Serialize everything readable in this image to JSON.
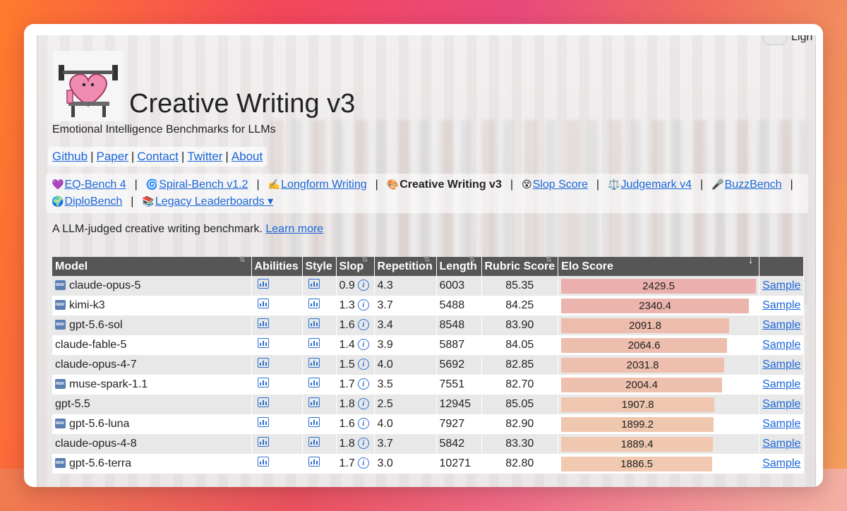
{
  "theme_toggle": {
    "label": "Ligh"
  },
  "header": {
    "title": "Creative Writing v3",
    "subtitle": "Emotional Intelligence Benchmarks for LLMs"
  },
  "links": [
    "Github",
    "Paper",
    "Contact",
    "Twitter",
    "About"
  ],
  "nav": [
    {
      "icon": "💜",
      "label": "EQ-Bench 4",
      "current": false
    },
    {
      "icon": "🌀",
      "label": "Spiral-Bench v1.2",
      "current": false
    },
    {
      "icon": "✍️",
      "label": "Longform Writing",
      "current": false
    },
    {
      "icon": "🎨",
      "label": "Creative Writing v3",
      "current": true
    },
    {
      "icon": "😵",
      "label": "Slop Score",
      "current": false
    },
    {
      "icon": "⚖️",
      "label": "Judgemark v4",
      "current": false
    },
    {
      "icon": "🎤",
      "label": "BuzzBench",
      "current": false
    },
    {
      "icon": "🌍",
      "label": "DiploBench",
      "current": false
    },
    {
      "icon": "📚",
      "label": "Legacy Leaderboards ▾",
      "current": false
    }
  ],
  "description": {
    "text": "A LLM-judged creative writing benchmark.",
    "link": "Learn more"
  },
  "table": {
    "columns": [
      "Model",
      "Abilities",
      "Style",
      "Slop",
      "Repetition",
      "Length",
      "Rubric Score",
      "Elo Score",
      ""
    ],
    "sample_label": "Sample",
    "elo_max": 2429.5,
    "rows": [
      {
        "model": "claude-opus-5",
        "new": true,
        "slop": "0.9",
        "repetition": "4.3",
        "length": "6003",
        "rubric": "85.35",
        "elo": 2429.5,
        "elo_label": "2429.5",
        "bar_color": "#ebb0ae"
      },
      {
        "model": "kimi-k3",
        "new": true,
        "slop": "1.3",
        "repetition": "3.7",
        "length": "5488",
        "rubric": "84.25",
        "elo": 2340.4,
        "elo_label": "2340.4",
        "bar_color": "#ebb4ad"
      },
      {
        "model": "gpt-5.6-sol",
        "new": true,
        "slop": "1.6",
        "repetition": "3.4",
        "length": "8548",
        "rubric": "83.90",
        "elo": 2091.8,
        "elo_label": "2091.8",
        "bar_color": "#edbcad"
      },
      {
        "model": "claude-fable-5",
        "new": false,
        "slop": "1.4",
        "repetition": "3.9",
        "length": "5887",
        "rubric": "84.05",
        "elo": 2064.6,
        "elo_label": "2064.6",
        "bar_color": "#edbdad"
      },
      {
        "model": "claude-opus-4-7",
        "new": false,
        "slop": "1.5",
        "repetition": "4.0",
        "length": "5692",
        "rubric": "82.85",
        "elo": 2031.8,
        "elo_label": "2031.8",
        "bar_color": "#eebfae"
      },
      {
        "model": "muse-spark-1.1",
        "new": true,
        "slop": "1.7",
        "repetition": "3.5",
        "length": "7551",
        "rubric": "82.70",
        "elo": 2004.4,
        "elo_label": "2004.4",
        "bar_color": "#eec1ae"
      },
      {
        "model": "gpt-5.5",
        "new": false,
        "slop": "1.8",
        "repetition": "2.5",
        "length": "12945",
        "rubric": "85.05",
        "elo": 1907.8,
        "elo_label": "1907.8",
        "bar_color": "#efc6af"
      },
      {
        "model": "gpt-5.6-luna",
        "new": true,
        "slop": "1.6",
        "repetition": "4.0",
        "length": "7927",
        "rubric": "82.90",
        "elo": 1899.2,
        "elo_label": "1899.2",
        "bar_color": "#efc7af"
      },
      {
        "model": "claude-opus-4-8",
        "new": false,
        "slop": "1.8",
        "repetition": "3.7",
        "length": "5842",
        "rubric": "83.30",
        "elo": 1889.4,
        "elo_label": "1889.4",
        "bar_color": "#f0c8b0"
      },
      {
        "model": "gpt-5.6-terra",
        "new": true,
        "slop": "1.7",
        "repetition": "3.0",
        "length": "10271",
        "rubric": "82.80",
        "elo": 1886.5,
        "elo_label": "1886.5",
        "bar_color": "#f0c9b0"
      }
    ]
  }
}
